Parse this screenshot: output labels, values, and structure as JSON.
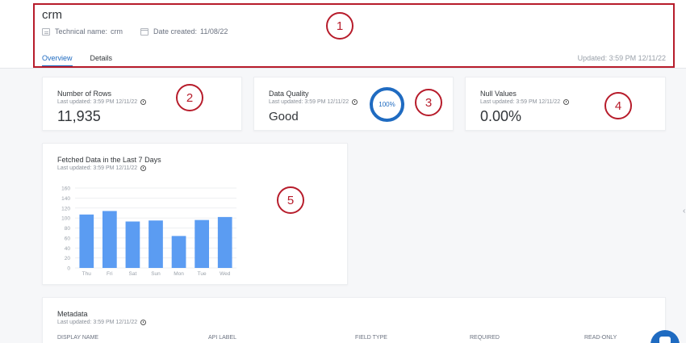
{
  "header": {
    "title": "crm",
    "technical_name_label": "Technical name:",
    "technical_name_value": "crm",
    "date_created_label": "Date created:",
    "date_created_value": "11/08/22",
    "tabs": [
      "Overview",
      "Details"
    ],
    "active_tab": "Overview",
    "updated": "Updated: 3:59 PM 12/11/22"
  },
  "cards": {
    "rows": {
      "title": "Number of Rows",
      "sub": "Last updated: 3:59 PM 12/11/22",
      "value": "11,935"
    },
    "quality": {
      "title": "Data Quality",
      "sub": "Last updated: 3:59 PM 12/11/22",
      "value": "Good",
      "ring_label": "100%"
    },
    "nulls": {
      "title": "Null Values",
      "sub": "Last updated: 3:59 PM 12/11/22",
      "value": "0.00%"
    }
  },
  "chart_card": {
    "title": "Fetched Data in the Last 7 Days",
    "sub": "Last updated: 3:59 PM 12/11/22"
  },
  "chart_data": {
    "type": "bar",
    "categories": [
      "Thu",
      "Fri",
      "Sat",
      "Sun",
      "Mon",
      "Tue",
      "Wed"
    ],
    "values": [
      107,
      114,
      93,
      95,
      64,
      96,
      102
    ],
    "ylim": [
      0,
      160
    ],
    "yticks": [
      0,
      20,
      40,
      60,
      80,
      100,
      120,
      140,
      160
    ],
    "grid": true,
    "bar_color": "#5b9cf2"
  },
  "metadata": {
    "title": "Metadata",
    "sub": "Last updated: 3:59 PM 12/11/22",
    "columns": [
      "DISPLAY NAME",
      "API LABEL",
      "FIELD TYPE",
      "REQUIRED",
      "READ-ONLY"
    ]
  },
  "markers": [
    "1",
    "2",
    "3",
    "4",
    "5"
  ],
  "colors": {
    "accent": "#1f6bc1",
    "marker": "#b71c2b"
  }
}
